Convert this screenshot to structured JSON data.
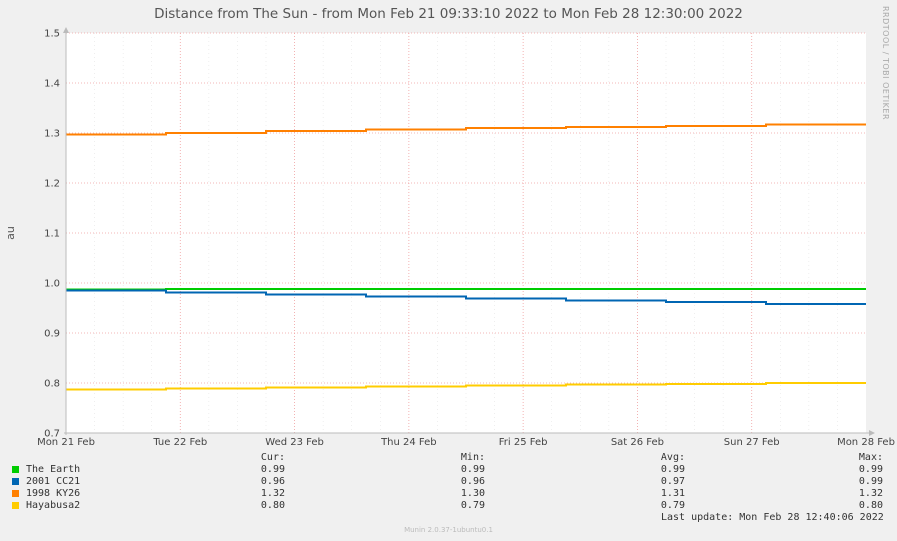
{
  "chart_data": {
    "type": "line",
    "title": "Distance from The Sun - from Mon Feb 21 09:33:10 2022 to Mon Feb 28 12:30:00 2022",
    "ylabel": "au",
    "ylim": [
      0.7,
      1.5
    ],
    "yticks": [
      "0.7",
      "0.8",
      "0.9",
      "1.0",
      "1.1",
      "1.2",
      "1.3",
      "1.4",
      "1.5"
    ],
    "x_dates": [
      "Mon 21 Feb",
      "Tue 22 Feb",
      "Wed 23 Feb",
      "Thu 24 Feb",
      "Fri 25 Feb",
      "Sat 26 Feb",
      "Sun 27 Feb",
      "Mon 28 Feb"
    ],
    "grid": true,
    "series": [
      {
        "name": "The Earth",
        "color": "#00cc00",
        "values": [
          0.987,
          0.988,
          0.988,
          0.988,
          0.988,
          0.988,
          0.988,
          0.988
        ]
      },
      {
        "name": "2001 CC21",
        "color": "#0066b3",
        "values": [
          0.985,
          0.981,
          0.977,
          0.973,
          0.969,
          0.965,
          0.962,
          0.958
        ]
      },
      {
        "name": "1998 KY26",
        "color": "#ff8000",
        "values": [
          1.297,
          1.3,
          1.304,
          1.307,
          1.31,
          1.312,
          1.314,
          1.317
        ]
      },
      {
        "name": "Hayabusa2",
        "color": "#ffcc00",
        "values": [
          0.787,
          0.789,
          0.791,
          0.793,
          0.795,
          0.797,
          0.798,
          0.8
        ]
      }
    ]
  },
  "legend": {
    "headers": {
      "cur": "Cur:",
      "min": "Min:",
      "avg": "Avg:",
      "max": "Max:"
    },
    "rows": [
      {
        "name": "The Earth",
        "color": "#00cc00",
        "cur": "0.99",
        "min": "0.99",
        "avg": "0.99",
        "max": "0.99"
      },
      {
        "name": "2001 CC21",
        "color": "#0066b3",
        "cur": "0.96",
        "min": "0.96",
        "avg": "0.97",
        "max": "0.99"
      },
      {
        "name": "1998 KY26",
        "color": "#ff8000",
        "cur": "1.32",
        "min": "1.30",
        "avg": "1.31",
        "max": "1.32"
      },
      {
        "name": "Hayabusa2",
        "color": "#ffcc00",
        "cur": "0.80",
        "min": "0.79",
        "avg": "0.79",
        "max": "0.80"
      }
    ]
  },
  "last_update": "Last update: Mon Feb 28 12:40:06 2022",
  "vendor_label": "RRDTOOL / TOBI OETIKER",
  "footer": "Munin 2.0.37-1ubuntu0.1"
}
